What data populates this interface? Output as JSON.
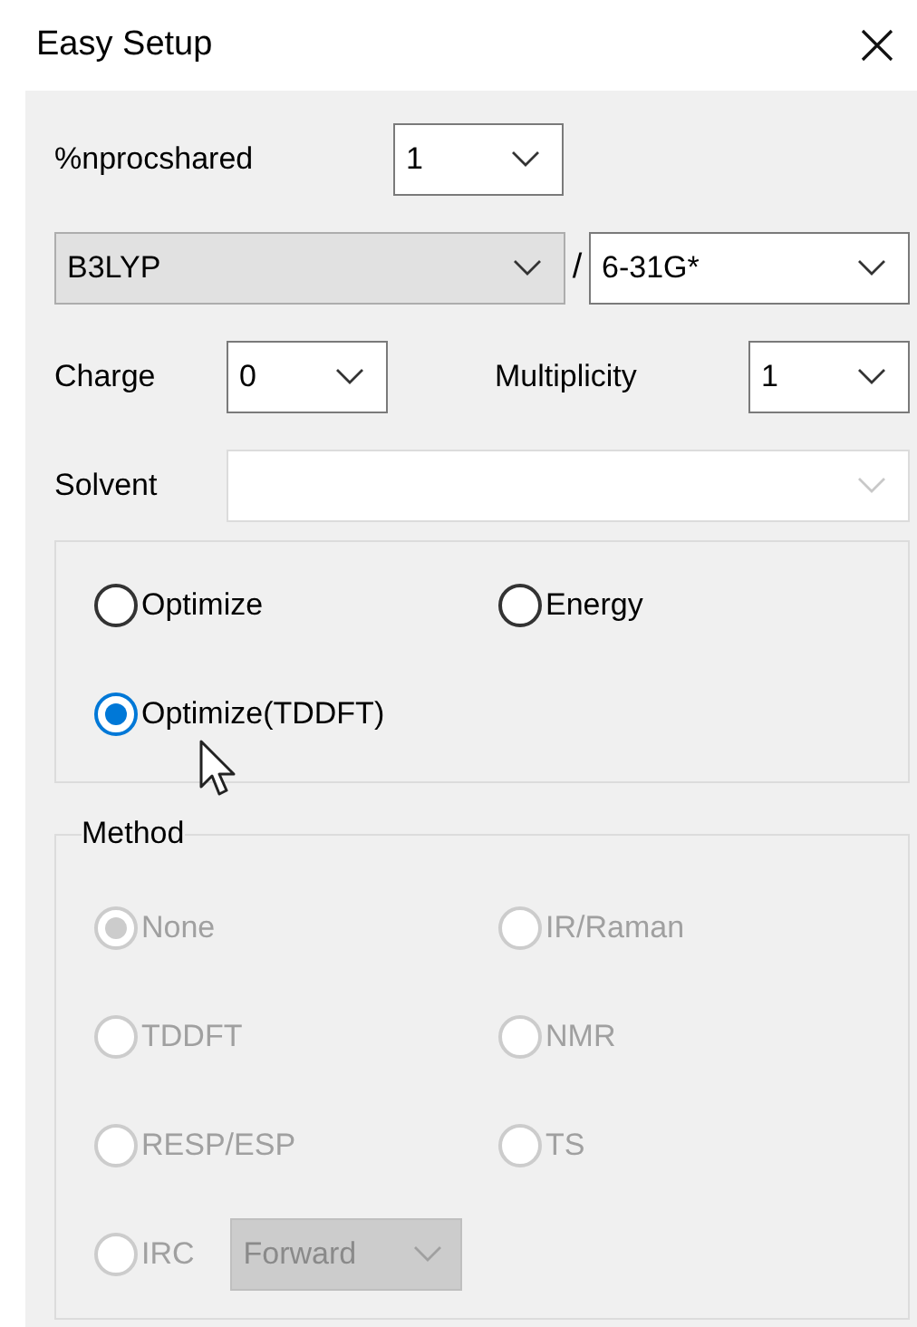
{
  "window": {
    "title": "Easy Setup"
  },
  "nprocshared": {
    "label": "%nprocshared",
    "value": "1"
  },
  "level_of_theory": {
    "functional": {
      "value": "B3LYP",
      "editable": false
    },
    "separator": "/",
    "basis_set": {
      "value": "6-31G*",
      "editable": true
    }
  },
  "charge": {
    "label": "Charge",
    "value": "0"
  },
  "multiplicity": {
    "label": "Multiplicity",
    "value": "1"
  },
  "solvent": {
    "label": "Solvent",
    "disabled": true
  },
  "job_types": [
    {
      "label": "Optimize",
      "selected": false
    },
    {
      "label": "Energy",
      "selected": false
    },
    {
      "label": "Optimize(TDDFT)",
      "selected": true
    }
  ],
  "method_group": {
    "title": "Method",
    "disabled": true,
    "options": [
      {
        "label": "None",
        "selected": true
      },
      {
        "label": "IR/Raman",
        "selected": false
      },
      {
        "label": "TDDFT",
        "selected": false
      },
      {
        "label": "NMR",
        "selected": false
      },
      {
        "label": "RESP/ESP",
        "selected": false
      },
      {
        "label": "TS",
        "selected": false
      },
      {
        "label": "IRC",
        "selected": false,
        "direction": {
          "value": "Forward",
          "disabled": true
        }
      }
    ]
  }
}
